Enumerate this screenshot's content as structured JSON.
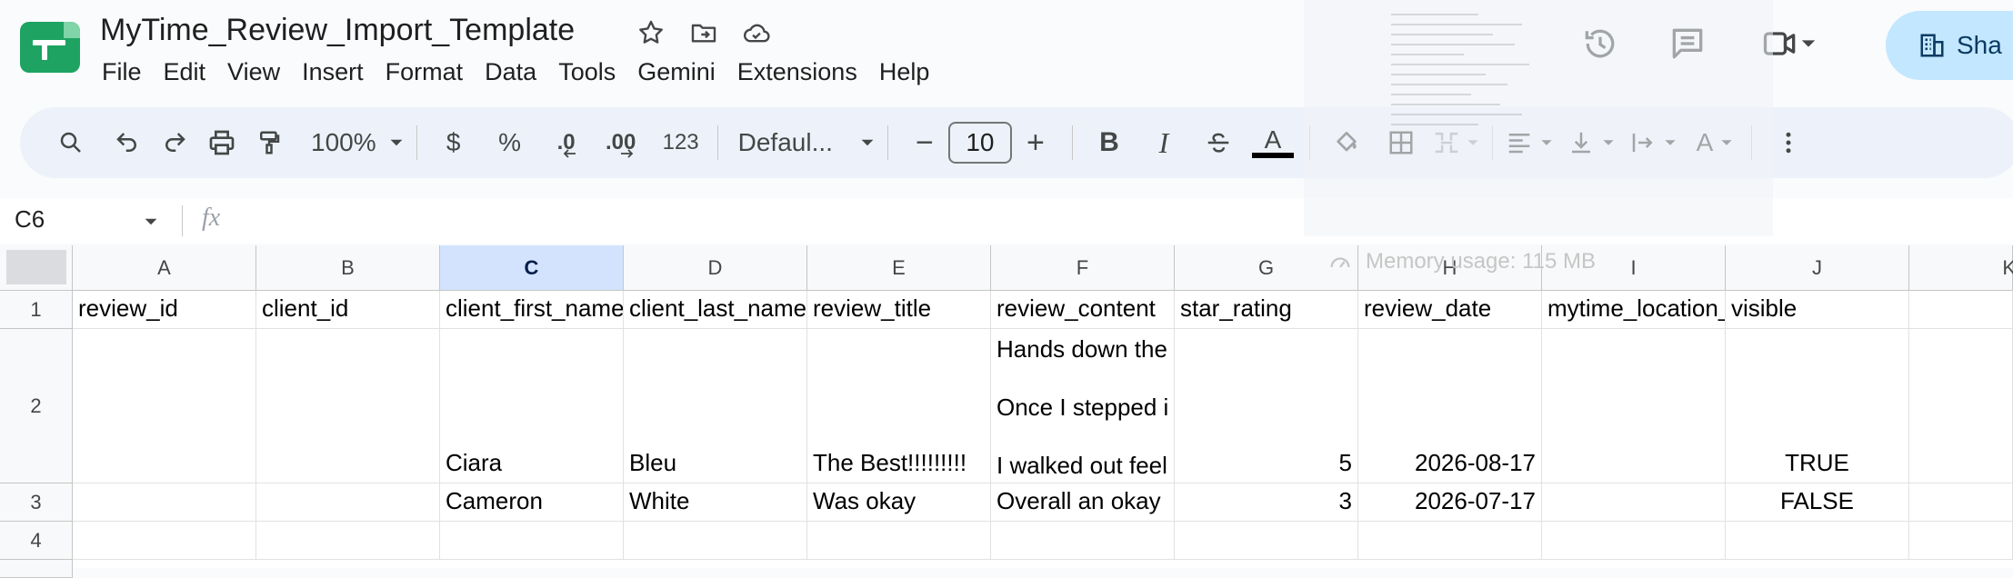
{
  "header": {
    "doc_title": "MyTime_Review_Import_Template",
    "menu": [
      "File",
      "Edit",
      "View",
      "Insert",
      "Format",
      "Data",
      "Tools",
      "Gemini",
      "Extensions",
      "Help"
    ],
    "share_label": "Sha",
    "icons": [
      "star-icon",
      "move-to-folder-icon",
      "cloud-saved-icon",
      "history-icon",
      "comments-icon",
      "meet-icon"
    ]
  },
  "toolbar": {
    "zoom": "100%",
    "currency": "$",
    "percent": "%",
    "dec_decrease": ".0",
    "dec_increase": ".00",
    "number_format": "123",
    "font": "Defaul...",
    "font_size": "10",
    "minus": "−",
    "plus": "+",
    "bold": "B",
    "italic": "I",
    "text_color_letter": "A",
    "rotate_letter": "A"
  },
  "formula_bar": {
    "name_box": "C6",
    "fx": "fx"
  },
  "overlay": {
    "memory_usage": "Memory usage: 115 MB"
  },
  "grid": {
    "columns": [
      "A",
      "B",
      "C",
      "D",
      "E",
      "F",
      "G",
      "H",
      "I",
      "J",
      "K"
    ],
    "selected_column": "C",
    "rows": [
      "1",
      "2",
      "3",
      "4"
    ],
    "row1": {
      "A": "review_id",
      "B": "client_id",
      "C": "client_first_name",
      "D": "client_last_name",
      "E": "review_title",
      "F": "review_content",
      "G": "star_rating",
      "H": "review_date",
      "I": "mytime_location_id",
      "J": "visible"
    },
    "row2": {
      "C": "Ciara",
      "D": "Bleu",
      "E": "The Best!!!!!!!!!",
      "F_line1": "Hands down the",
      "F_line2": "Once I stepped i",
      "F_line3": "I walked out feel",
      "G": "5",
      "H": "2026-08-17",
      "J": "TRUE"
    },
    "row3": {
      "C": "Cameron",
      "D": "White",
      "E": "Was okay",
      "F": "Overall an okay",
      "G": "3",
      "H": "2026-07-17",
      "J": "FALSE"
    }
  }
}
